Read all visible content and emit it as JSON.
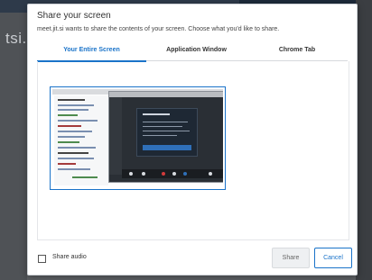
{
  "background": {
    "app_logo_fragment": "tsi."
  },
  "dialog": {
    "title": "Share your screen",
    "subtitle": "meet.jit.si wants to share the contents of your screen. Choose what you'd like to share.",
    "tabs": [
      {
        "label": "Your Entire Screen",
        "selected": true
      },
      {
        "label": "Application Window",
        "selected": false
      },
      {
        "label": "Chrome Tab",
        "selected": false
      }
    ],
    "preview": {
      "selected": true
    },
    "footer": {
      "share_audio_label": "Share audio",
      "share_audio_checked": false,
      "share_label": "Share",
      "cancel_label": "Cancel"
    }
  },
  "colors": {
    "accent": "#1a73c9",
    "backdrop": "#5e6165"
  }
}
